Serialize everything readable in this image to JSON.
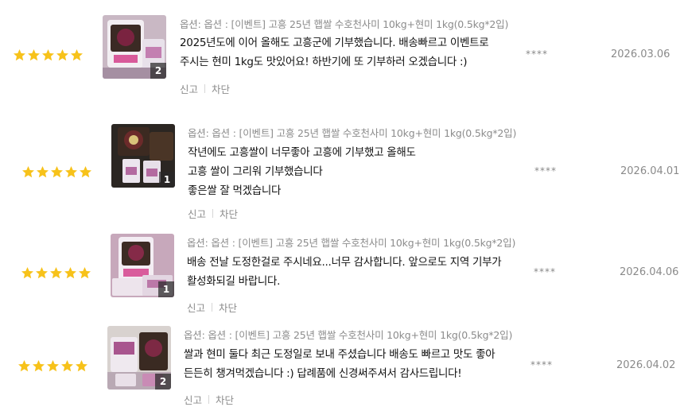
{
  "colors": {
    "star": "#f7c21a",
    "muted": "#8c8c8c",
    "text": "#111111"
  },
  "reviews": [
    {
      "rating": 5,
      "photo_count": "2",
      "option": "옵션: 옵션 : [이벤트] 고흥 25년 햅쌀 수호천사미 10kg+현미 1kg(0.5kg*2입)",
      "lines": [
        "2025년도에 이어 올해도 고흥군에 기부했습니다. 배송빠르고 이벤트로",
        "주시는 현미 1kg도 맛있어요! 하반기에 또 기부하러 오겠습니다 :)"
      ],
      "report": "신고",
      "block": "차단",
      "user": "****",
      "date": "2026.03.06"
    },
    {
      "rating": 5,
      "photo_count": "1",
      "option": "옵션: 옵션 : [이벤트] 고흥 25년 햅쌀 수호천사미 10kg+현미 1kg(0.5kg*2입)",
      "lines": [
        "작년에도 고흥쌀이 너무좋아 고흥에 기부했고 올해도",
        "고흥 쌀이 그리워 기부했습니다",
        "좋은쌀 잘 먹겠습니다"
      ],
      "report": "신고",
      "block": "차단",
      "user": "****",
      "date": "2026.04.01"
    },
    {
      "rating": 5,
      "photo_count": "1",
      "option": "옵션: 옵션 : [이벤트] 고흥 25년 햅쌀 수호천사미 10kg+현미 1kg(0.5kg*2입)",
      "lines": [
        "배송 전날 도정한걸로 주시네요...너무 감사합니다. 앞으로도 지역 기부가",
        "활성화되길 바랍니다."
      ],
      "report": "신고",
      "block": "차단",
      "user": "****",
      "date": "2026.04.06"
    },
    {
      "rating": 5,
      "photo_count": "2",
      "option": "옵션: 옵션 : [이벤트] 고흥 25년 햅쌀 수호천사미 10kg+현미 1kg(0.5kg*2입)",
      "lines": [
        "쌀과 현미 둘다 최근 도정일로 보내 주셨습니다 배송도 빠르고 맛도 좋아",
        "든든히 챙겨먹겠습니다 :) 답례품에 신경써주셔서 감사드립니다!"
      ],
      "report": "신고",
      "block": "차단",
      "user": "****",
      "date": "2026.04.02"
    }
  ]
}
